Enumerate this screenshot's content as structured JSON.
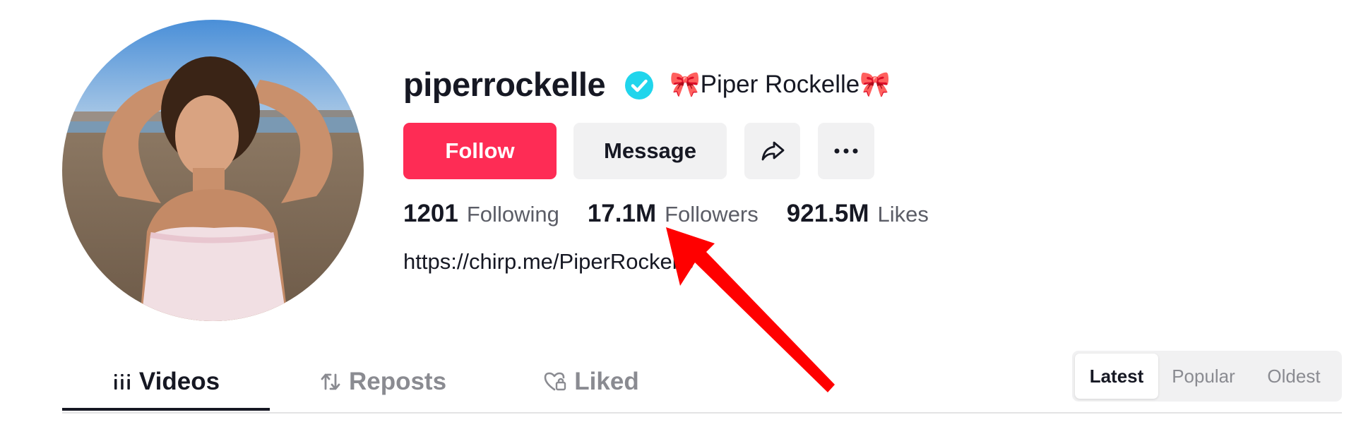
{
  "profile": {
    "username": "piperrockelle",
    "nickname_prefix": "🎀",
    "nickname_text": "Piper Rockelle",
    "nickname_suffix": "🎀",
    "bio_link": "https://chirp.me/PiperRockelle"
  },
  "actions": {
    "follow_label": "Follow",
    "message_label": "Message"
  },
  "stats": {
    "following_count": "1201",
    "following_label": "Following",
    "followers_count": "17.1M",
    "followers_label": "Followers",
    "likes_count": "921.5M",
    "likes_label": "Likes"
  },
  "tabs": {
    "videos": "Videos",
    "reposts": "Reposts",
    "liked": "Liked"
  },
  "sort": {
    "options": [
      "Latest",
      "Popular",
      "Oldest"
    ],
    "selected": "Latest"
  },
  "colors": {
    "brand": "#fe2c55",
    "verified": "#20d5ec",
    "annotation_arrow": "#ff0000"
  },
  "icons": {
    "verified": "verified-badge-icon",
    "share": "share-arrow-icon",
    "more": "more-dots-icon",
    "videos": "grid-icon",
    "reposts": "repost-icon",
    "liked": "heart-lock-icon"
  }
}
